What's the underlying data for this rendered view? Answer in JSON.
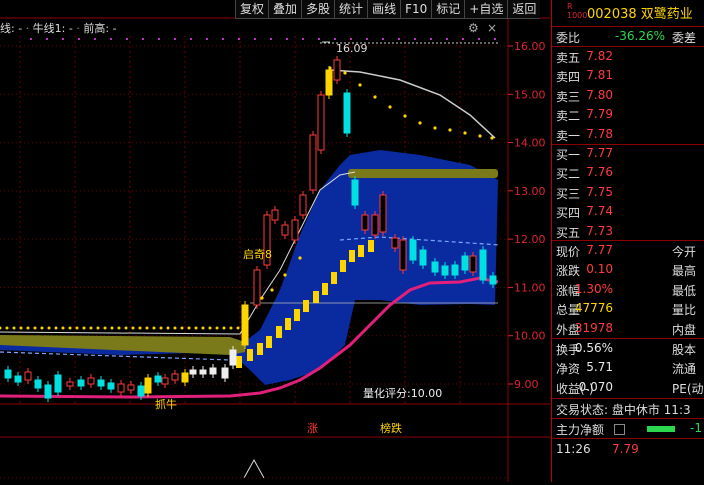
{
  "toolbar": {
    "buttons": [
      "复权",
      "叠加",
      "多股",
      "统计",
      "画线",
      "F10",
      "标记",
      "+自选",
      "返回"
    ]
  },
  "legend": {
    "text_a": "线: -",
    "text_b": "牛线1: -",
    "text_c": "前高: -"
  },
  "chart": {
    "y_ticks": [
      "16.00",
      "15.00",
      "14.00",
      "13.00",
      "12.00",
      "11.00",
      "10.00",
      "9.00"
    ],
    "peak_label": "16.09",
    "label_qiqi": "启奇8",
    "label_zhuaniu": "抓牛",
    "score_label": "量化评分:10.00",
    "marker_zhang": "涨",
    "marker_bangdie": "榜跌"
  },
  "quote": {
    "badge": "R\n1000",
    "code_name": "002038 双鹭药业",
    "webi_label": "委比",
    "webi_value": "-36.26%",
    "webi_label2": "委差",
    "sell": [
      {
        "label": "卖五",
        "price": "7.82"
      },
      {
        "label": "卖四",
        "price": "7.81"
      },
      {
        "label": "卖三",
        "price": "7.80"
      },
      {
        "label": "卖二",
        "price": "7.79"
      },
      {
        "label": "卖一",
        "price": "7.78"
      }
    ],
    "buy": [
      {
        "label": "买一",
        "price": "7.77"
      },
      {
        "label": "买二",
        "price": "7.76"
      },
      {
        "label": "买三",
        "price": "7.75"
      },
      {
        "label": "买四",
        "price": "7.74"
      },
      {
        "label": "买五",
        "price": "7.73"
      }
    ],
    "stats": [
      {
        "label": "现价",
        "value": "7.77",
        "label2": "今开",
        "color": "red"
      },
      {
        "label": "涨跌",
        "value": "0.10",
        "label2": "最高",
        "color": "red"
      },
      {
        "label": "涨幅",
        "value": "1.30%",
        "label2": "最低",
        "color": "red"
      },
      {
        "label": "总量",
        "value": "47776",
        "label2": "量比",
        "color": "yel"
      },
      {
        "label": "外盘",
        "value": "31978",
        "label2": "内盘",
        "color": "red"
      }
    ],
    "stats2": [
      {
        "label": "换手",
        "value": "0.56%",
        "label2": "股本"
      },
      {
        "label": "净资",
        "value": "5.71",
        "label2": "流通"
      },
      {
        "label": "收益(-)",
        "value": "0.070",
        "label2": "PE(动"
      }
    ],
    "status": "交易状态: 盘中休市 11:3",
    "main_net_label": "主力净额",
    "main_net_value": "-1",
    "tick_time": "11:26",
    "tick_price": "7.79"
  },
  "colors": {
    "up": "#ff3b3b",
    "down": "#2bd84d",
    "accent": "#ffd500",
    "band_blue": "#0a2aa0",
    "band_olive": "#7a7a1a",
    "pink_line": "#e0207a"
  }
}
